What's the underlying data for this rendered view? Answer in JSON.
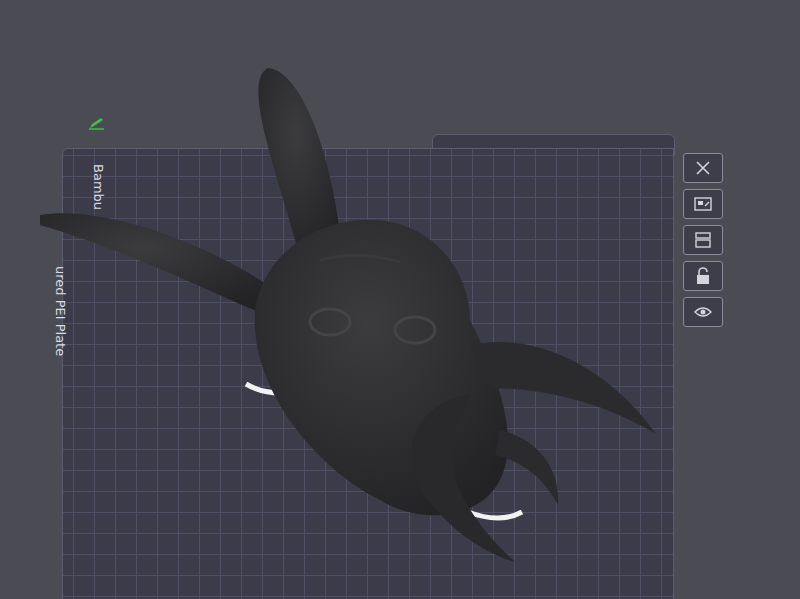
{
  "viewport": {
    "plate_label": [
      "Bambu",
      "ured PEI Plate"
    ]
  },
  "plate_tools": [
    {
      "kind": "delete"
    },
    {
      "kind": "arrange"
    },
    {
      "kind": "layout"
    },
    {
      "kind": "lock",
      "locked": false
    },
    {
      "kind": "view"
    }
  ]
}
